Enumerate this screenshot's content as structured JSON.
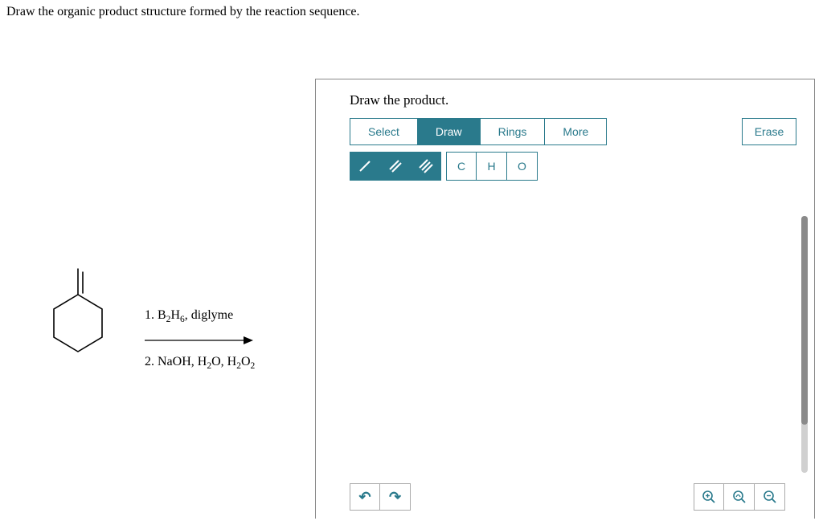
{
  "question_prompt": "Draw the organic product structure formed by the reaction sequence.",
  "panel_title": "Draw the product.",
  "tabs": {
    "select": "Select",
    "draw": "Draw",
    "rings": "Rings",
    "more": "More"
  },
  "erase": "Erase",
  "bond_tools": {
    "single": "/",
    "double": "//",
    "triple": "///"
  },
  "atom_tools": {
    "c": "C",
    "h": "H",
    "o": "O"
  },
  "reagents": {
    "line1_prefix": "1. B",
    "line1_sub1": "2",
    "line1_mid": "H",
    "line1_sub2": "6",
    "line1_suffix": ", diglyme",
    "line2_prefix": "2. NaOH, H",
    "line2_sub1": "2",
    "line2_mid": "O, H",
    "line2_sub2": "2",
    "line2_mid2": "O",
    "line2_sub3": "2"
  },
  "icons": {
    "undo": "↶",
    "redo": "↷",
    "zoom_in": "⊕",
    "reset_view": "⤡",
    "zoom_out": "⊖"
  }
}
